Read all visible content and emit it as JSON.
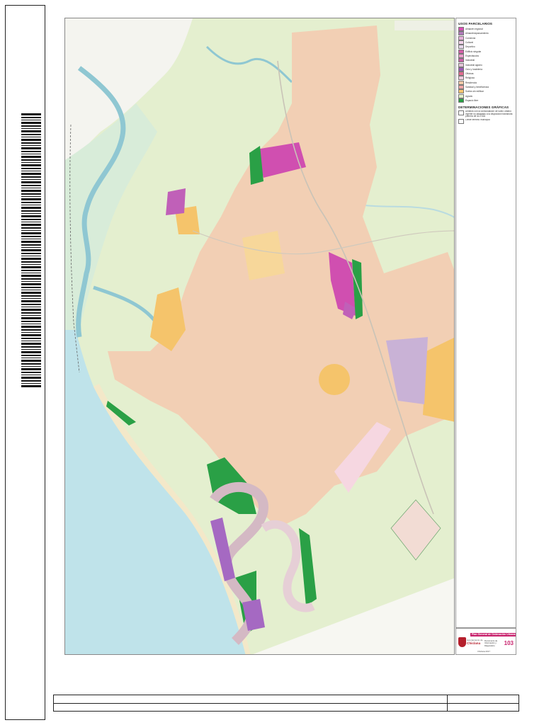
{
  "sheet": {
    "sheet_number": "103",
    "municipality": "Ayuntamiento de",
    "municipality_name": "Chiclana",
    "plan_title": "Plan General de Ordenación Urbana",
    "plan_subtitle": "",
    "document_label": "Documento de Información y Diagnóstico",
    "scale_note": "",
    "footer": "Chiclana 2017"
  },
  "legend": {
    "title_uses": "USOS PARCELARIOS",
    "uses": [
      {
        "label": "Almacén regional",
        "color": "#d84fb5"
      },
      {
        "label": "Almacén/aparcamiento",
        "color": "#b07ab9"
      },
      {
        "label": "Comercial",
        "color": "#e9b3dc"
      },
      {
        "label": "Cultural",
        "color": "#f3d3ea"
      },
      {
        "label": "Deportivo",
        "color": "#e8d9ec"
      },
      {
        "label": "Edificio singular",
        "color": "#d35fa8"
      },
      {
        "label": "Espectáculos",
        "color": "#ec9fcd"
      },
      {
        "label": "Industrial",
        "color": "#c65fa4"
      },
      {
        "label": "Industrial agrario",
        "color": "#e5c5d9"
      },
      {
        "label": "Ocio y hostelería",
        "color": "#9b59b6"
      },
      {
        "label": "Oficinas",
        "color": "#e26b8f"
      },
      {
        "label": "Religioso",
        "color": "#f1cce0"
      },
      {
        "label": "Residencial",
        "color": "#f2c9a8"
      },
      {
        "label": "Sanidad y beneficencia",
        "color": "#f4a8a8"
      },
      {
        "label": "Suelos sin edificar",
        "color": "#f6c56e"
      },
      {
        "label": "Agrario",
        "color": "#e7f1c9"
      },
      {
        "label": "Espacio libre",
        "color": "#27a043"
      }
    ],
    "title_graphic": "DETERMINACIONES GRÁFICAS",
    "graphic": [
      {
        "label": "Ámbitos con la consolidación de suelo urbano vigente no adaptado a la disposición transitoria primera de la LOUA"
      },
      {
        "label": "Límite término municipal"
      }
    ]
  },
  "bottom_table": {
    "row1_main": "",
    "row1_side": "",
    "row2_main": "",
    "row2_side": ""
  },
  "colors": {
    "agrario": "#e4efcf",
    "residential": "#f2cfb4",
    "vacant": "#f5c46b",
    "commercial": "#d04fb0",
    "greenspace": "#2aa046",
    "industrial_land": "#c9b2d6",
    "sea": "#bfe3ea",
    "marsh": "#d8ecd9",
    "river": "#8fc7d2"
  },
  "icons": {
    "barcode": "barcode-icon",
    "coat_of_arms": "coat-of-arms-icon"
  }
}
